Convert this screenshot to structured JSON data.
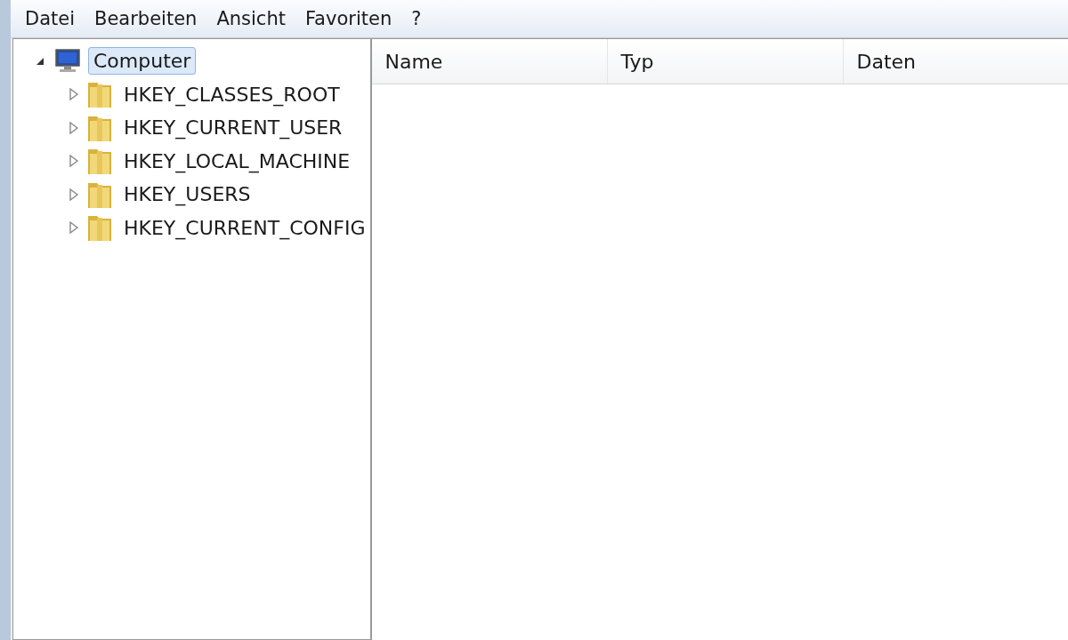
{
  "menu": [
    "Datei",
    "Bearbeiten",
    "Ansicht",
    "Favoriten",
    "?"
  ],
  "tree": [
    {
      "label": "Computer",
      "kind": "computer",
      "expanded": true,
      "selected": true,
      "children": [
        {
          "label": "HKEY_CLASSES_ROOT",
          "kind": "folder",
          "expanded": false,
          "selected": false
        },
        {
          "label": "HKEY_CURRENT_USER",
          "kind": "folder",
          "expanded": false,
          "selected": false
        },
        {
          "label": "HKEY_LOCAL_MACHINE",
          "kind": "folder",
          "expanded": false,
          "selected": false
        },
        {
          "label": "HKEY_USERS",
          "kind": "folder",
          "expanded": false,
          "selected": false
        },
        {
          "label": "HKEY_CURRENT_CONFIG",
          "kind": "folder",
          "expanded": false,
          "selected": false
        }
      ]
    }
  ],
  "list": {
    "columns": [
      "Name",
      "Typ",
      "Daten"
    ]
  }
}
